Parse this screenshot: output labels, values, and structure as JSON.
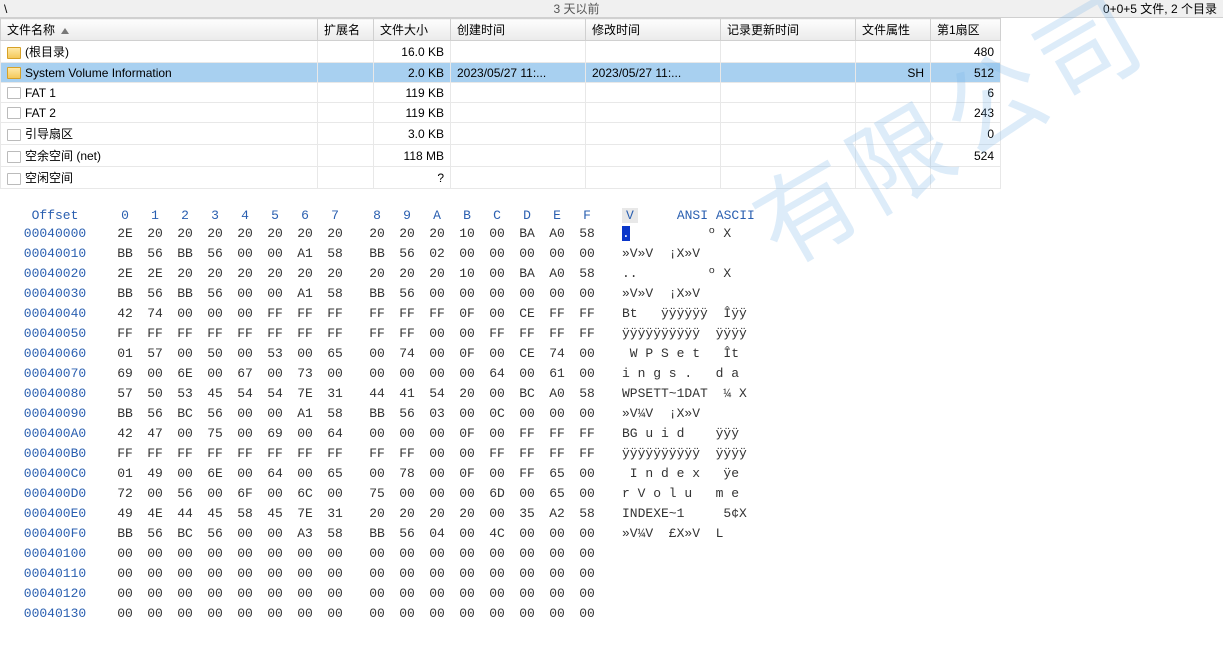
{
  "header": {
    "path": "\\",
    "age": "3 天以前",
    "summary": "0+0+5 文件, 2 个目录"
  },
  "columns": {
    "name": "文件名称",
    "ext": "扩展名",
    "size": "文件大小",
    "created": "创建时间",
    "modified": "修改时间",
    "record": "记录更新时间",
    "attr": "文件属性",
    "sector": "第1扇区"
  },
  "rows": [
    {
      "icon": "folder",
      "name": "(根目录)",
      "ext": "",
      "size": "16.0 KB",
      "created": "",
      "modified": "",
      "record": "",
      "attr": "",
      "sector": "480",
      "sel": false
    },
    {
      "icon": "folder",
      "name": "System Volume Information",
      "ext": "",
      "size": "2.0 KB",
      "created": "2023/05/27  11:...",
      "modified": "2023/05/27  11:...",
      "record": "",
      "attr": "SH",
      "sector": "512",
      "sel": true
    },
    {
      "icon": "file",
      "name": "FAT 1",
      "ext": "",
      "size": "119 KB",
      "created": "",
      "modified": "",
      "record": "",
      "attr": "",
      "sector": "6",
      "sel": false
    },
    {
      "icon": "file",
      "name": "FAT 2",
      "ext": "",
      "size": "119 KB",
      "created": "",
      "modified": "",
      "record": "",
      "attr": "",
      "sector": "243",
      "sel": false
    },
    {
      "icon": "file",
      "name": "引导扇区",
      "ext": "",
      "size": "3.0 KB",
      "created": "",
      "modified": "",
      "record": "",
      "attr": "",
      "sector": "0",
      "sel": false
    },
    {
      "icon": "file",
      "name": "空余空间 (net)",
      "ext": "",
      "size": "118 MB",
      "created": "",
      "modified": "",
      "record": "",
      "attr": "",
      "sector": "524",
      "sel": false
    },
    {
      "icon": "file",
      "name": "空闲空间",
      "ext": "",
      "size": "?",
      "created": "",
      "modified": "",
      "record": "",
      "attr": "",
      "sector": "",
      "sel": false
    }
  ],
  "hex": {
    "offset_label": "Offset",
    "cols": [
      "0",
      "1",
      "2",
      "3",
      "4",
      "5",
      "6",
      "7",
      "8",
      "9",
      "A",
      "B",
      "C",
      "D",
      "E",
      "F"
    ],
    "cursor_col": "V",
    "ascii_label": "ANSI ASCII",
    "rows": [
      {
        "off": "00040000",
        "b": [
          "2E",
          "20",
          "20",
          "20",
          "20",
          "20",
          "20",
          "20",
          "20",
          "20",
          "20",
          "10",
          "00",
          "BA",
          "A0",
          "58"
        ],
        "a": ".          º X",
        "selFirst": true
      },
      {
        "off": "00040010",
        "b": [
          "BB",
          "56",
          "BB",
          "56",
          "00",
          "00",
          "A1",
          "58",
          "BB",
          "56",
          "02",
          "00",
          "00",
          "00",
          "00",
          "00"
        ],
        "a": "»V»V  ¡X»V"
      },
      {
        "off": "00040020",
        "b": [
          "2E",
          "2E",
          "20",
          "20",
          "20",
          "20",
          "20",
          "20",
          "20",
          "20",
          "20",
          "10",
          "00",
          "BA",
          "A0",
          "58"
        ],
        "a": "..         º X"
      },
      {
        "off": "00040030",
        "b": [
          "BB",
          "56",
          "BB",
          "56",
          "00",
          "00",
          "A1",
          "58",
          "BB",
          "56",
          "00",
          "00",
          "00",
          "00",
          "00",
          "00"
        ],
        "a": "»V»V  ¡X»V"
      },
      {
        "off": "00040040",
        "b": [
          "42",
          "74",
          "00",
          "00",
          "00",
          "FF",
          "FF",
          "FF",
          "FF",
          "FF",
          "FF",
          "0F",
          "00",
          "CE",
          "FF",
          "FF"
        ],
        "a": "Bt   ÿÿÿÿÿÿ  Îÿÿ"
      },
      {
        "off": "00040050",
        "b": [
          "FF",
          "FF",
          "FF",
          "FF",
          "FF",
          "FF",
          "FF",
          "FF",
          "FF",
          "FF",
          "00",
          "00",
          "FF",
          "FF",
          "FF",
          "FF"
        ],
        "a": "ÿÿÿÿÿÿÿÿÿÿ  ÿÿÿÿ"
      },
      {
        "off": "00040060",
        "b": [
          "01",
          "57",
          "00",
          "50",
          "00",
          "53",
          "00",
          "65",
          "00",
          "74",
          "00",
          "0F",
          "00",
          "CE",
          "74",
          "00"
        ],
        "a": " W P S e t   Ît"
      },
      {
        "off": "00040070",
        "b": [
          "69",
          "00",
          "6E",
          "00",
          "67",
          "00",
          "73",
          "00",
          "00",
          "00",
          "00",
          "00",
          "64",
          "00",
          "61",
          "00"
        ],
        "a": "i n g s .   d a"
      },
      {
        "off": "00040080",
        "b": [
          "57",
          "50",
          "53",
          "45",
          "54",
          "54",
          "7E",
          "31",
          "44",
          "41",
          "54",
          "20",
          "00",
          "BC",
          "A0",
          "58"
        ],
        "a": "WPSETT~1DAT  ¼ X"
      },
      {
        "off": "00040090",
        "b": [
          "BB",
          "56",
          "BC",
          "56",
          "00",
          "00",
          "A1",
          "58",
          "BB",
          "56",
          "03",
          "00",
          "0C",
          "00",
          "00",
          "00"
        ],
        "a": "»V¼V  ¡X»V"
      },
      {
        "off": "000400A0",
        "b": [
          "42",
          "47",
          "00",
          "75",
          "00",
          "69",
          "00",
          "64",
          "00",
          "00",
          "00",
          "0F",
          "00",
          "FF",
          "FF",
          "FF"
        ],
        "a": "BG u i d    ÿÿÿ"
      },
      {
        "off": "000400B0",
        "b": [
          "FF",
          "FF",
          "FF",
          "FF",
          "FF",
          "FF",
          "FF",
          "FF",
          "FF",
          "FF",
          "00",
          "00",
          "FF",
          "FF",
          "FF",
          "FF"
        ],
        "a": "ÿÿÿÿÿÿÿÿÿÿ  ÿÿÿÿ"
      },
      {
        "off": "000400C0",
        "b": [
          "01",
          "49",
          "00",
          "6E",
          "00",
          "64",
          "00",
          "65",
          "00",
          "78",
          "00",
          "0F",
          "00",
          "FF",
          "65",
          "00"
        ],
        "a": " I n d e x   ÿe"
      },
      {
        "off": "000400D0",
        "b": [
          "72",
          "00",
          "56",
          "00",
          "6F",
          "00",
          "6C",
          "00",
          "75",
          "00",
          "00",
          "00",
          "6D",
          "00",
          "65",
          "00"
        ],
        "a": "r V o l u   m e"
      },
      {
        "off": "000400E0",
        "b": [
          "49",
          "4E",
          "44",
          "45",
          "58",
          "45",
          "7E",
          "31",
          "20",
          "20",
          "20",
          "20",
          "00",
          "35",
          "A2",
          "58"
        ],
        "a": "INDEXE~1     5¢X"
      },
      {
        "off": "000400F0",
        "b": [
          "BB",
          "56",
          "BC",
          "56",
          "00",
          "00",
          "A3",
          "58",
          "BB",
          "56",
          "04",
          "00",
          "4C",
          "00",
          "00",
          "00"
        ],
        "a": "»V¼V  £X»V  L"
      },
      {
        "off": "00040100",
        "b": [
          "00",
          "00",
          "00",
          "00",
          "00",
          "00",
          "00",
          "00",
          "00",
          "00",
          "00",
          "00",
          "00",
          "00",
          "00",
          "00"
        ],
        "a": ""
      },
      {
        "off": "00040110",
        "b": [
          "00",
          "00",
          "00",
          "00",
          "00",
          "00",
          "00",
          "00",
          "00",
          "00",
          "00",
          "00",
          "00",
          "00",
          "00",
          "00"
        ],
        "a": ""
      },
      {
        "off": "00040120",
        "b": [
          "00",
          "00",
          "00",
          "00",
          "00",
          "00",
          "00",
          "00",
          "00",
          "00",
          "00",
          "00",
          "00",
          "00",
          "00",
          "00"
        ],
        "a": ""
      },
      {
        "off": "00040130",
        "b": [
          "00",
          "00",
          "00",
          "00",
          "00",
          "00",
          "00",
          "00",
          "00",
          "00",
          "00",
          "00",
          "00",
          "00",
          "00",
          "00"
        ],
        "a": ""
      }
    ]
  },
  "watermark": "有限公司"
}
